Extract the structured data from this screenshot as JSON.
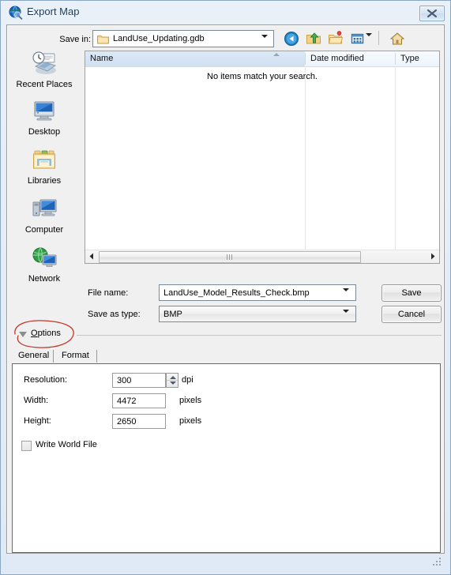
{
  "window": {
    "title": "Export Map",
    "icon": "export-map-globe-icon",
    "close_label": "Close"
  },
  "toolbar": {
    "save_in_label": "Save in:",
    "save_in_value": "LandUse_Updating.gdb",
    "save_in_icon": "folder-icon",
    "buttons": [
      {
        "name": "back-button",
        "icon": "back-arrow-icon"
      },
      {
        "name": "up-one-level-button",
        "icon": "up-folder-icon"
      },
      {
        "name": "create-new-folder-button",
        "icon": "new-folder-icon"
      },
      {
        "name": "views-button",
        "icon": "views-grid-icon"
      },
      {
        "name": "home-button",
        "icon": "home-icon"
      }
    ]
  },
  "places": [
    {
      "label": "Recent Places",
      "icon": "recent-places-icon"
    },
    {
      "label": "Desktop",
      "icon": "desktop-icon"
    },
    {
      "label": "Libraries",
      "icon": "libraries-icon"
    },
    {
      "label": "Computer",
      "icon": "computer-icon"
    },
    {
      "label": "Network",
      "icon": "network-icon"
    }
  ],
  "file_list": {
    "columns": [
      "Name",
      "Date modified",
      "Type"
    ],
    "sorted_column": "Name",
    "sort_direction": "ascending",
    "rows": [],
    "empty_message": "No items match your search."
  },
  "file_fields": {
    "file_name_label": "File name:",
    "file_name_value": "LandUse_Model_Results_Check.bmp",
    "save_as_type_label": "Save as type:",
    "save_as_type_value": "BMP"
  },
  "buttons": {
    "save": "Save",
    "cancel": "Cancel"
  },
  "options": {
    "toggle_label": "Options",
    "toggle_accel": "O",
    "toggle_rest": "ptions",
    "expanded": true,
    "tabs": [
      {
        "label": "General",
        "active": true
      },
      {
        "label": "Format",
        "active": false
      }
    ],
    "general": {
      "resolution_label": "Resolution:",
      "resolution_value": "300",
      "resolution_units": "dpi",
      "width_label": "Width:",
      "width_value": "4472",
      "width_units": "pixels",
      "height_label": "Height:",
      "height_value": "2650",
      "height_units": "pixels",
      "write_world_file_label": "Write World File",
      "write_world_file_checked": false
    }
  },
  "annotation": {
    "shape": "red-ellipse-highlight",
    "target": "Options",
    "color": "#c0392b"
  },
  "colors": {
    "titlebar_start": "#e9f0f8",
    "titlebar_end": "#dfeaf6",
    "dialog_face": "#f0f0f0",
    "list_background": "#ffffff",
    "header_selected": "#dce9f7",
    "annotation_red": "#c0392b"
  }
}
